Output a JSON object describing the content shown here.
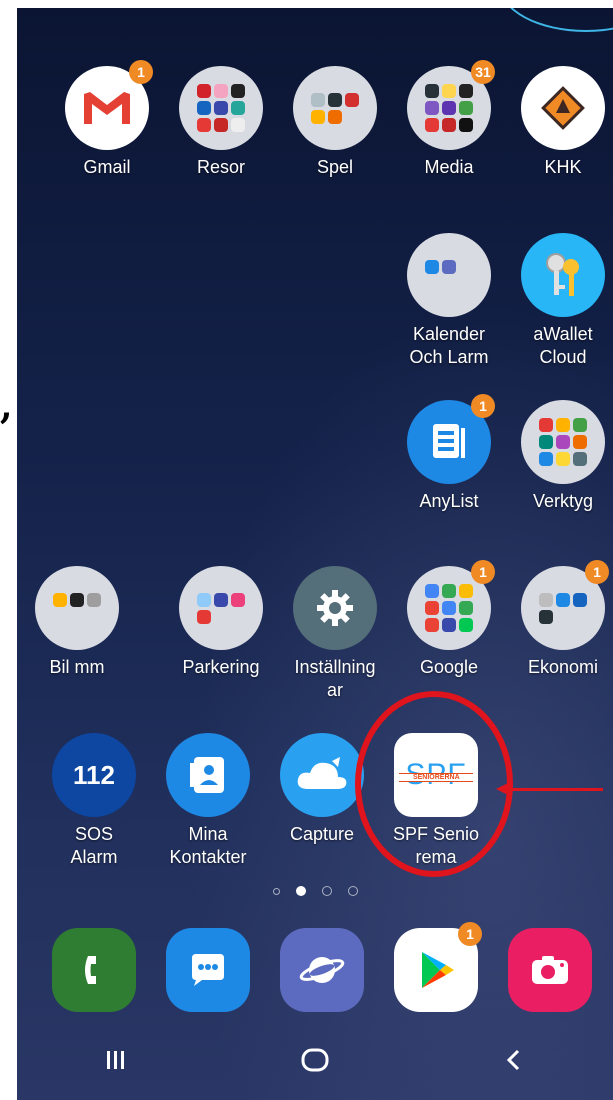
{
  "side_mark": ",",
  "apps": {
    "gmail": {
      "label": "Gmail",
      "badge": "1"
    },
    "resor": {
      "label": "Resor"
    },
    "spel": {
      "label": "Spel"
    },
    "media": {
      "label": "Media",
      "badge": "31"
    },
    "khk": {
      "label": "KHK"
    },
    "kalender": {
      "label": "Kalender\nOch Larm"
    },
    "awallet": {
      "label": "aWallet\nCloud"
    },
    "anylist": {
      "label": "AnyList",
      "badge": "1"
    },
    "verktyg": {
      "label": "Verktyg"
    },
    "bilmm": {
      "label": "Bil mm"
    },
    "parkering": {
      "label": "Parkering"
    },
    "installningar": {
      "label": "Inställning\nar"
    },
    "google": {
      "label": "Google",
      "badge": "1"
    },
    "ekonomi": {
      "label": "Ekonomi",
      "badge": "1"
    },
    "sos": {
      "label": "SOS\nAlarm",
      "icon_text": "112"
    },
    "kontakter": {
      "label": "Mina\nKontakter"
    },
    "capture": {
      "label": "Capture"
    },
    "spf": {
      "label": "SPF Senio\nrema",
      "icon_text": "SPF",
      "icon_subtext": "SENIORERNA"
    }
  },
  "dock": {
    "play_badge": "1"
  },
  "page_indicator": {
    "count": 4,
    "active": 1
  },
  "colors": {
    "badge": "#f08a24",
    "highlight": "#e0141c",
    "wallpaper_top": "#0b1533",
    "wallpaper_bottom": "#2a3766"
  },
  "icons": {
    "phone": "phone-icon",
    "messages": "messages-icon",
    "internet": "internet-icon",
    "play_store": "play-store-icon",
    "camera": "camera-icon",
    "recents": "recents-icon",
    "home": "home-icon",
    "back": "back-icon"
  }
}
